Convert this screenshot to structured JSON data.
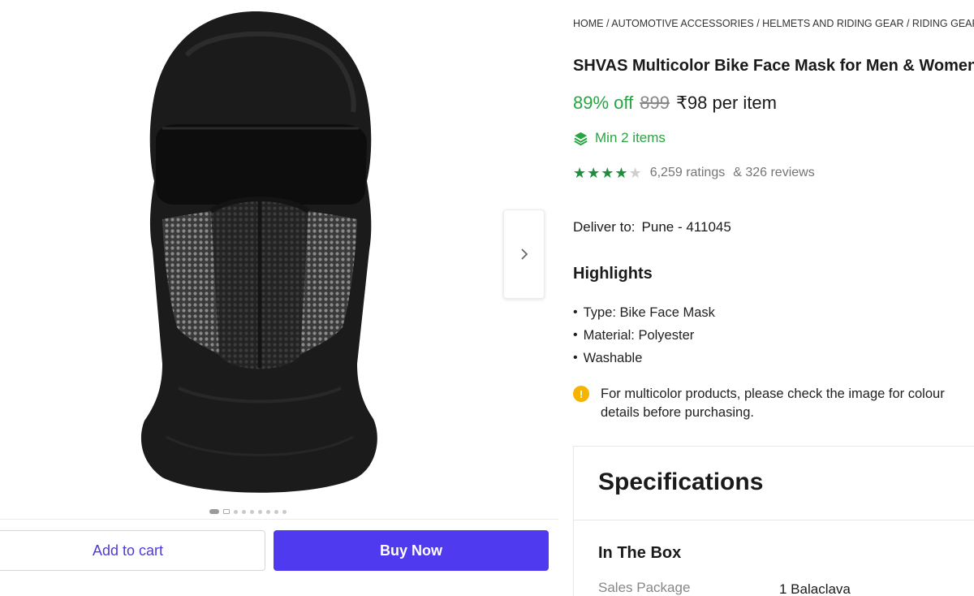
{
  "gallery": {
    "image_alt": "Black balaclava bike face mask",
    "next_icon": "chevron-right-icon",
    "total_images": 9,
    "active_index": 0
  },
  "actions": {
    "add_to_cart": "Add to cart",
    "buy_now": "Buy Now"
  },
  "breadcrumb": "HOME / AUTOMOTIVE ACCESSORIES / HELMETS AND RIDING GEAR / RIDING GEAR",
  "product": {
    "title": "SHVAS Multicolor Bike Face Mask for Men & Women",
    "discount": "89% off",
    "mrp": "899",
    "price": "₹98 per item",
    "min_items": "Min 2 items",
    "rating_value": 4,
    "ratings": "6,259 ratings",
    "reviews": "& 326 reviews"
  },
  "delivery": {
    "label": "Deliver to:",
    "location": "Pune - 411045"
  },
  "highlights": {
    "title": "Highlights",
    "items": [
      "Type: Bike Face Mask",
      "Material: Polyester",
      "Washable"
    ]
  },
  "note": "For multicolor products, please check the image for colour details before purchasing.",
  "specifications": {
    "title": "Specifications",
    "section": "In The Box",
    "rows": [
      {
        "key": "Sales Package",
        "value": "1 Balaclava"
      }
    ]
  },
  "colors": {
    "accent": "#4f3af0",
    "green": "#26a541",
    "info": "#f4b400"
  }
}
